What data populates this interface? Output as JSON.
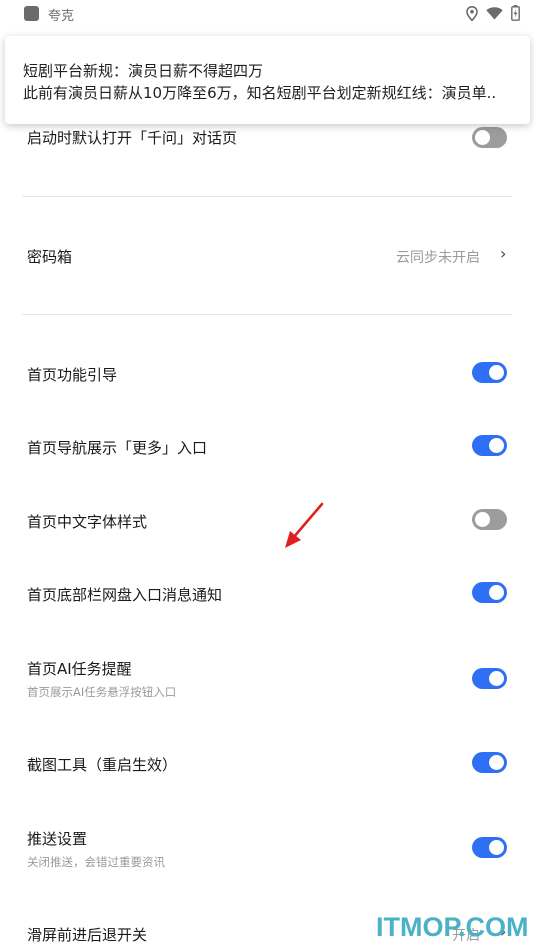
{
  "status_bar": {
    "app_name": "夸克"
  },
  "notification": {
    "title": "短剧平台新规：演员日薪不得超四万",
    "body": "此前有演员日薪从10万降至6万，知名短剧平台划定新规红线：演员单.."
  },
  "settings": {
    "open_qianwen": {
      "label": "启动时默认打开「千问」对话页",
      "enabled": false
    },
    "password_box": {
      "label": "密码箱",
      "value": "云同步未开启"
    },
    "home_guide": {
      "label": "首页功能引导",
      "enabled": true
    },
    "home_nav_more": {
      "label": "首页导航展示「更多」入口",
      "enabled": true
    },
    "home_font_style": {
      "label": "首页中文字体样式",
      "enabled": false
    },
    "home_netdisk_notice": {
      "label": "首页底部栏网盘入口消息通知",
      "enabled": true
    },
    "home_ai_task": {
      "label": "首页AI任务提醒",
      "sub": "首页展示AI任务悬浮按钮入口",
      "enabled": true
    },
    "screenshot_tool": {
      "label": "截图工具（重启生效）",
      "enabled": true
    },
    "push_settings": {
      "label": "推送设置",
      "sub": "关闭推送，会错过重要资讯",
      "enabled": true
    },
    "swipe_nav": {
      "label": "滑屏前进后退开关",
      "value": "开启"
    }
  },
  "watermark": {
    "text": "ITMOP.COM"
  },
  "colors": {
    "toggle_on": "#2f6ff3",
    "toggle_off": "#9c9c9c",
    "arrow": "#e02020",
    "watermark": "#4ab1c6"
  }
}
